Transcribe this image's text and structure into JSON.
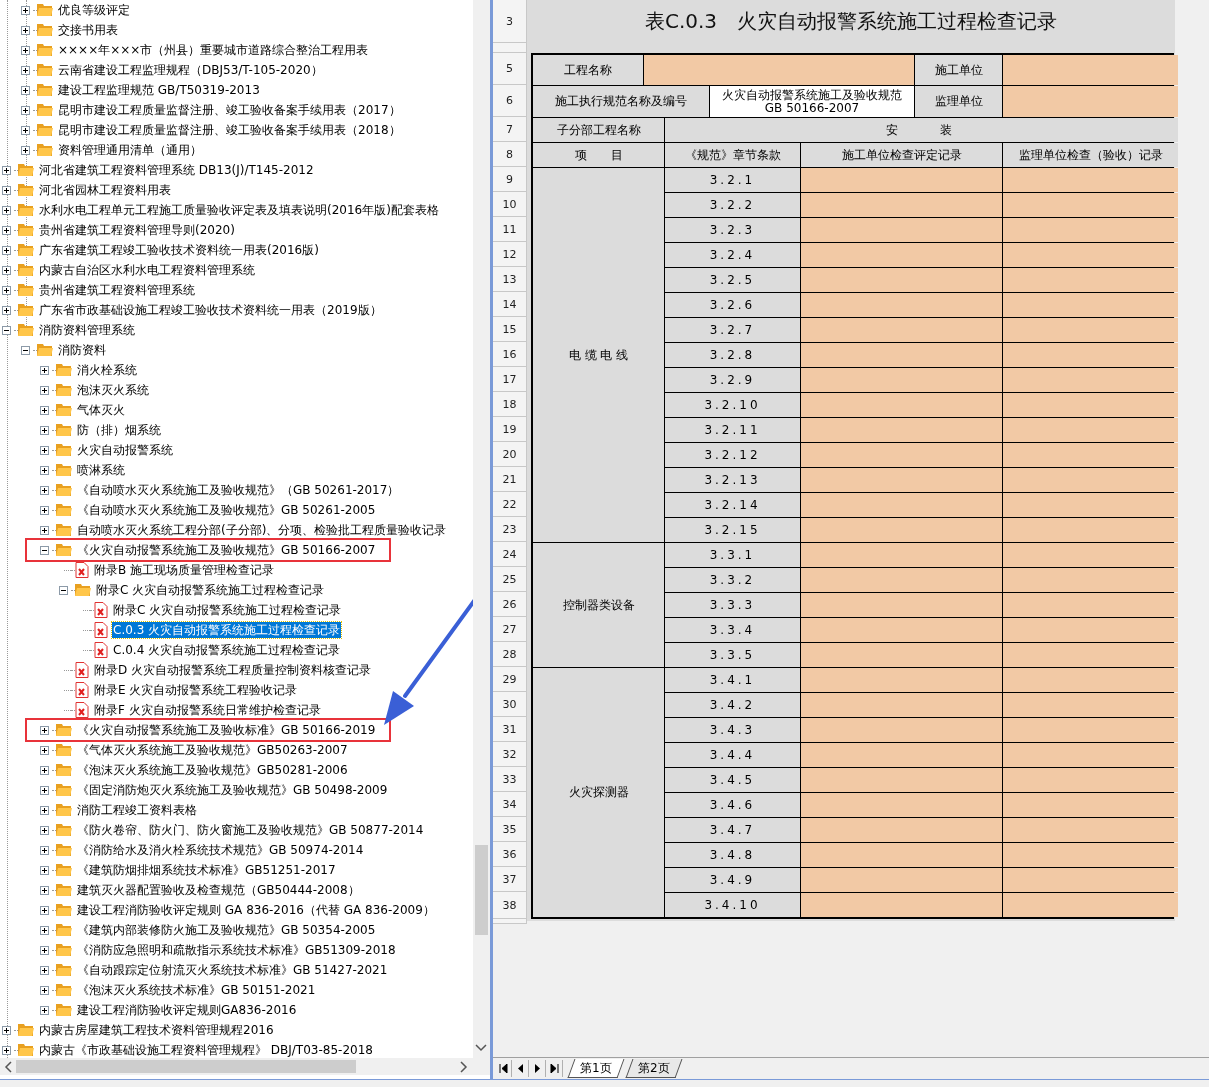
{
  "tree": {
    "scrolled_children": [
      {
        "label": "优良等级评定",
        "kind": "folder",
        "expanded": false,
        "selected": false,
        "marked": false
      },
      {
        "label": "交接书用表",
        "kind": "folder",
        "expanded": false,
        "selected": false,
        "marked": false
      },
      {
        "label": "××××年×××市（州县）重要城市道路综合整治工程用表",
        "kind": "folder",
        "expanded": false,
        "selected": false,
        "marked": false
      },
      {
        "label": "云南省建设工程监理规程（DBJ53/T-105-2020）",
        "kind": "folder",
        "expanded": false,
        "selected": false,
        "marked": false
      },
      {
        "label": "建设工程监理规范 GB/T50319-2013",
        "kind": "folder",
        "expanded": false,
        "selected": false,
        "marked": false
      },
      {
        "label": "昆明市建设工程质量监督注册、竣工验收备案手续用表（2017）",
        "kind": "folder",
        "expanded": false,
        "selected": false,
        "marked": false
      },
      {
        "label": "昆明市建设工程质量监督注册、竣工验收备案手续用表（2018）",
        "kind": "folder",
        "expanded": false,
        "selected": false,
        "marked": false
      },
      {
        "label": "资料管理通用清单（通用）",
        "kind": "folder",
        "expanded": false,
        "selected": false,
        "marked": false
      }
    ],
    "items": [
      {
        "label": "河北省建筑工程资料管理系统 DB13(J)/T145-2012",
        "kind": "folder",
        "expanded": false,
        "selected": false,
        "marked": false
      },
      {
        "label": "河北省园林工程资料用表",
        "kind": "folder",
        "expanded": false,
        "selected": false,
        "marked": false
      },
      {
        "label": "水利水电工程单元工程施工质量验收评定表及填表说明(2016年版)配套表格",
        "kind": "folder",
        "expanded": false,
        "selected": false,
        "marked": false
      },
      {
        "label": "贵州省建筑工程资料管理导则(2020)",
        "kind": "folder",
        "expanded": false,
        "selected": false,
        "marked": false
      },
      {
        "label": "广东省建筑工程竣工验收技术资料统一用表(2016版)",
        "kind": "folder",
        "expanded": false,
        "selected": false,
        "marked": false
      },
      {
        "label": "内蒙古自治区水利水电工程资料管理系统",
        "kind": "folder",
        "expanded": false,
        "selected": false,
        "marked": false
      },
      {
        "label": "贵州省建筑工程资料管理系统",
        "kind": "folder",
        "expanded": false,
        "selected": false,
        "marked": false
      },
      {
        "label": "广东省市政基础设施工程竣工验收技术资料统一用表（2019版）",
        "kind": "folder",
        "expanded": false,
        "selected": false,
        "marked": false
      },
      {
        "label": "消防资料管理系统",
        "kind": "folder",
        "expanded": true,
        "selected": false,
        "marked": false,
        "children": [
          {
            "label": "消防资料",
            "kind": "folder",
            "expanded": true,
            "selected": false,
            "marked": false,
            "children": [
              {
                "label": "消火栓系统",
                "kind": "folder",
                "expanded": false,
                "selected": false,
                "marked": false
              },
              {
                "label": "泡沫灭火系统",
                "kind": "folder",
                "expanded": false,
                "selected": false,
                "marked": false
              },
              {
                "label": "气体灭火",
                "kind": "folder",
                "expanded": false,
                "selected": false,
                "marked": false
              },
              {
                "label": "防（排）烟系统",
                "kind": "folder",
                "expanded": false,
                "selected": false,
                "marked": false
              },
              {
                "label": "火灾自动报警系统",
                "kind": "folder",
                "expanded": false,
                "selected": false,
                "marked": false
              },
              {
                "label": "喷淋系统",
                "kind": "folder",
                "expanded": false,
                "selected": false,
                "marked": false
              },
              {
                "label": "《自动喷水灭火系统施工及验收规范》（GB 50261-2017）",
                "kind": "folder",
                "expanded": false,
                "selected": false,
                "marked": false
              },
              {
                "label": "《自动喷水灭火系统施工及验收规范》GB 50261-2005",
                "kind": "folder",
                "expanded": false,
                "selected": false,
                "marked": false
              },
              {
                "label": "自动喷水灭火系统工程分部(子分部)、分项、检验批工程质量验收记录",
                "kind": "folder",
                "expanded": false,
                "selected": false,
                "marked": false
              },
              {
                "label": "《火灾自动报警系统施工及验收规范》GB 50166-2007",
                "kind": "folder",
                "expanded": true,
                "selected": false,
                "marked": true,
                "children": [
                  {
                    "label": "附录B 施工现场质量管理检查记录",
                    "kind": "file",
                    "selected": false,
                    "marked": false
                  },
                  {
                    "label": "附录C 火灾自动报警系统施工过程检查记录",
                    "kind": "folder",
                    "expanded": true,
                    "selected": false,
                    "marked": false,
                    "children": [
                      {
                        "label": "附录C 火灾自动报警系统施工过程检查记录",
                        "kind": "file",
                        "selected": false,
                        "marked": false
                      },
                      {
                        "label": "C.0.3 火灾自动报警系统施工过程检查记录",
                        "kind": "file",
                        "selected": true,
                        "marked": false
                      },
                      {
                        "label": "C.0.4 火灾自动报警系统施工过程检查记录",
                        "kind": "file",
                        "selected": false,
                        "marked": false
                      }
                    ]
                  },
                  {
                    "label": "附录D 火灾自动报警系统工程质量控制资料核查记录",
                    "kind": "file",
                    "selected": false,
                    "marked": false
                  },
                  {
                    "label": "附录E 火灾自动报警系统工程验收记录",
                    "kind": "file",
                    "selected": false,
                    "marked": false
                  },
                  {
                    "label": "附录F 火灾自动报警系统日常维护检查记录",
                    "kind": "file",
                    "selected": false,
                    "marked": false
                  }
                ]
              },
              {
                "label": "《火灾自动报警系统施工及验收标准》GB 50166-2019",
                "kind": "folder",
                "expanded": false,
                "selected": false,
                "marked": true
              },
              {
                "label": "《气体灭火系统施工及验收规范》GB50263-2007",
                "kind": "folder",
                "expanded": false,
                "selected": false,
                "marked": false
              },
              {
                "label": "《泡沫灭火系统施工及验收规范》GB50281-2006",
                "kind": "folder",
                "expanded": false,
                "selected": false,
                "marked": false
              },
              {
                "label": "《固定消防炮灭火系统施工及验收规范》GB 50498-2009",
                "kind": "folder",
                "expanded": false,
                "selected": false,
                "marked": false
              },
              {
                "label": "消防工程竣工资料表格",
                "kind": "folder",
                "expanded": false,
                "selected": false,
                "marked": false
              },
              {
                "label": "《防火卷帘、防火门、防火窗施工及验收规范》GB 50877-2014",
                "kind": "folder",
                "expanded": false,
                "selected": false,
                "marked": false
              },
              {
                "label": "《消防给水及消火栓系统技术规范》GB 50974-2014",
                "kind": "folder",
                "expanded": false,
                "selected": false,
                "marked": false
              },
              {
                "label": "《建筑防烟排烟系统技术标准》GB51251-2017",
                "kind": "folder",
                "expanded": false,
                "selected": false,
                "marked": false
              },
              {
                "label": "建筑灭火器配置验收及检查规范（GB50444-2008）",
                "kind": "folder",
                "expanded": false,
                "selected": false,
                "marked": false
              },
              {
                "label": "建设工程消防验收评定规则 GA 836-2016（代替 GA 836-2009）",
                "kind": "folder",
                "expanded": false,
                "selected": false,
                "marked": false
              },
              {
                "label": "《建筑内部装修防火施工及验收规范》GB 50354-2005",
                "kind": "folder",
                "expanded": false,
                "selected": false,
                "marked": false
              },
              {
                "label": "《消防应急照明和疏散指示系统技术标准》GB51309-2018",
                "kind": "folder",
                "expanded": false,
                "selected": false,
                "marked": false
              },
              {
                "label": "《自动跟踪定位射流灭火系统技术标准》GB 51427-2021",
                "kind": "folder",
                "expanded": false,
                "selected": false,
                "marked": false
              },
              {
                "label": "《泡沫灭火系统技术标准》GB 50151-2021",
                "kind": "folder",
                "expanded": false,
                "selected": false,
                "marked": false
              },
              {
                "label": "建设工程消防验收评定规则GA836-2016",
                "kind": "folder",
                "expanded": false,
                "selected": false,
                "marked": false
              }
            ]
          }
        ]
      },
      {
        "label": "内蒙古房屋建筑工程技术资料管理规程2016",
        "kind": "folder",
        "expanded": false,
        "selected": false,
        "marked": false
      },
      {
        "label": "内蒙古《市政基础设施工程资料管理规程》 DBJ/T03-85-2018",
        "kind": "folder",
        "expanded": false,
        "selected": false,
        "marked": false
      }
    ]
  },
  "sheet": {
    "row_numbers": [
      "3",
      "5",
      "6",
      "7",
      "8",
      "9",
      "10",
      "11",
      "12",
      "13",
      "14",
      "15",
      "16",
      "17",
      "18",
      "19",
      "20",
      "21",
      "22",
      "23",
      "24",
      "25",
      "26",
      "27",
      "28",
      "29",
      "30",
      "31",
      "32",
      "33",
      "34",
      "35",
      "36",
      "37",
      "38"
    ],
    "title": "表C.0.3　火灾自动报警系统施工过程检查记录",
    "project_name_label": "工程名称",
    "contractor_label": "施工单位",
    "standard_label": "施工执行规范名称及编号",
    "standard_value": "火灾自动报警系统施工及验收规范\nGB 50166-2007",
    "supervisor_label": "监理单位",
    "subdivision_label": "子分部工程名称",
    "subdivision_value": "安　　装",
    "columns": [
      "项　　目",
      "《规范》章节条款",
      "施工单位检查评定记录",
      "监理单位检查（验收）记录"
    ],
    "groups": [
      {
        "item": "电 缆 电 线",
        "clauses": [
          "3.2.1",
          "3.2.2",
          "3.2.3",
          "3.2.4",
          "3.2.5",
          "3.2.6",
          "3.2.7",
          "3.2.8",
          "3.2.9",
          "3.2.10",
          "3.2.11",
          "3.2.12",
          "3.2.13",
          "3.2.14",
          "3.2.15"
        ]
      },
      {
        "item": "控制器类设备",
        "clauses": [
          "3.3.1",
          "3.3.2",
          "3.3.3",
          "3.3.4",
          "3.3.5"
        ]
      },
      {
        "item": "火灾探测器",
        "clauses": [
          "3.4.1",
          "3.4.2",
          "3.4.3",
          "3.4.4",
          "3.4.5",
          "3.4.6",
          "3.4.7",
          "3.4.8",
          "3.4.9",
          "3.4.10"
        ]
      }
    ]
  },
  "sheet_tabs": [
    {
      "label": "第1页",
      "selected": true
    },
    {
      "label": "第2页",
      "selected": false
    }
  ]
}
